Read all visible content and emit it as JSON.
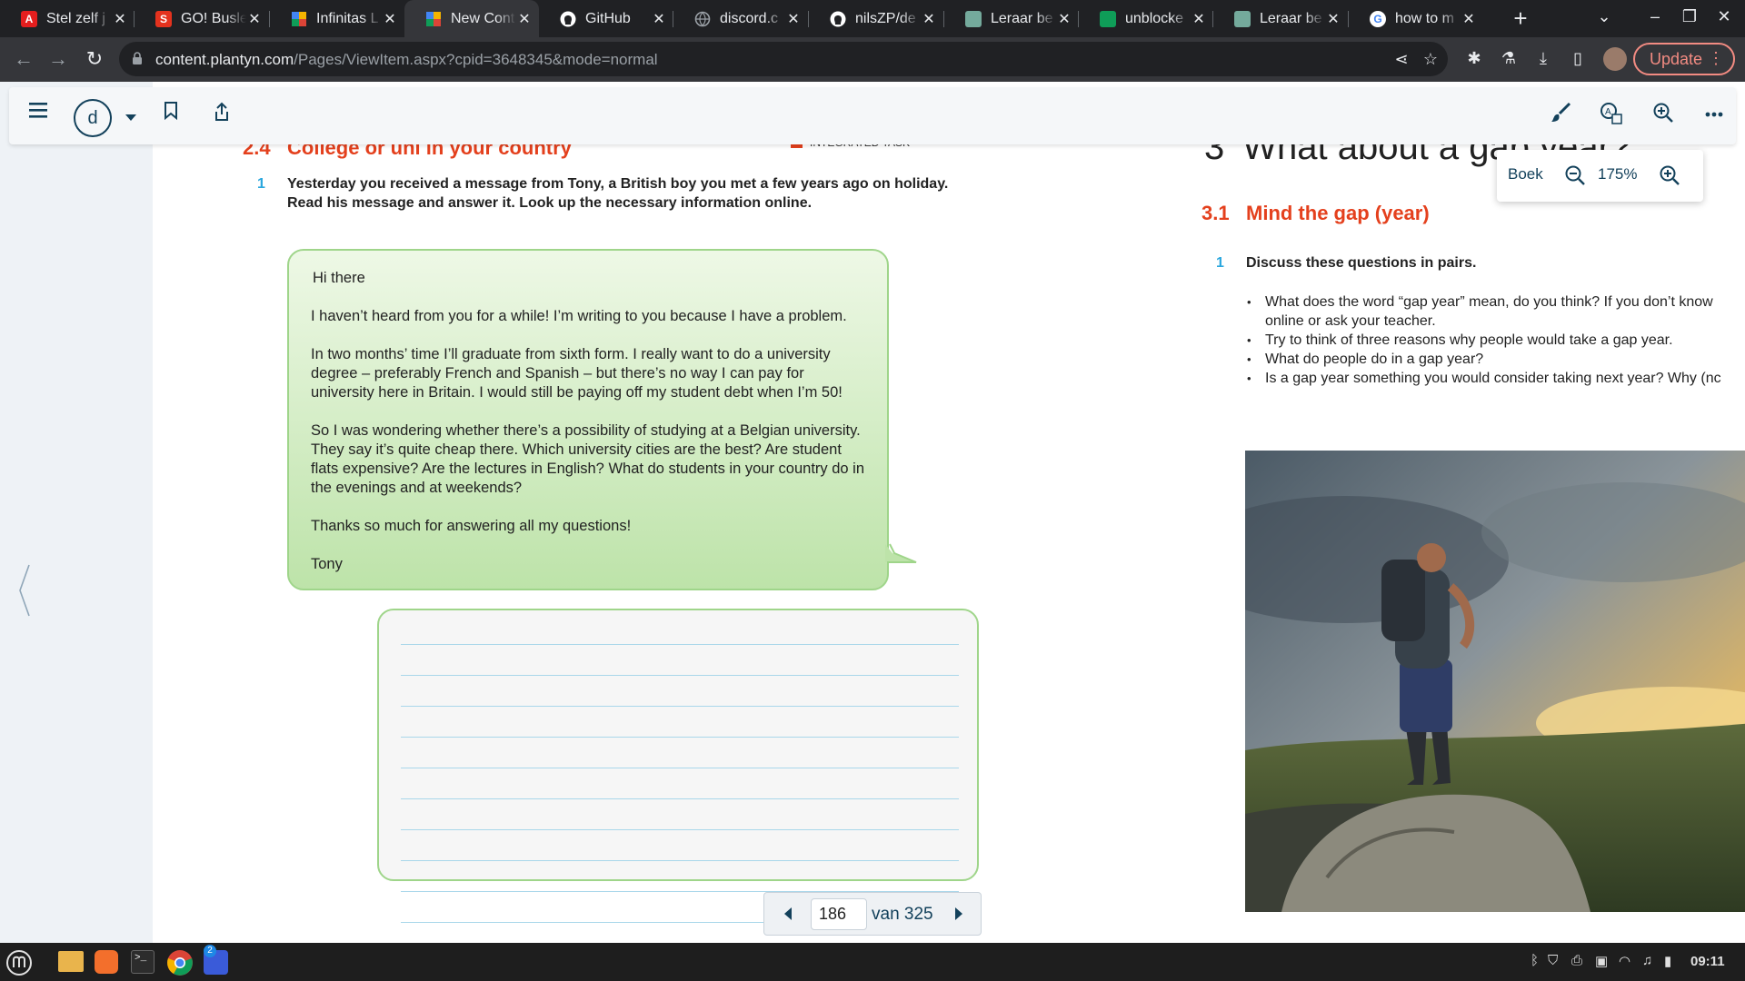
{
  "browser": {
    "tabs": [
      {
        "title": "Stel zelf j",
        "icon": "adobe-icon",
        "color": "#e41e1e",
        "glyph": "A"
      },
      {
        "title": "GO! Busle",
        "icon": "s-logo-icon",
        "color": "#e4321e",
        "glyph": "S"
      },
      {
        "title": "Infinitas L",
        "icon": "infinitas-icon",
        "color": "#f4b400",
        "glyph": ""
      },
      {
        "title": "New Cont",
        "icon": "new-content-icon",
        "color": "#f4b400",
        "glyph": ""
      },
      {
        "title": "GitHub",
        "icon": "github-icon",
        "color": "#ffffff",
        "glyph": ""
      },
      {
        "title": "discord.c",
        "icon": "globe-icon",
        "color": "#9aa0a6",
        "glyph": ""
      },
      {
        "title": "nilsZP/de",
        "icon": "github-icon",
        "color": "#ffffff",
        "glyph": ""
      },
      {
        "title": "Leraar be",
        "icon": "chatgpt-icon",
        "color": "#74aa9c",
        "glyph": ""
      },
      {
        "title": "unblocke",
        "icon": "sheets-icon",
        "color": "#0f9d58",
        "glyph": ""
      },
      {
        "title": "Leraar be",
        "icon": "chatgpt-icon",
        "color": "#74aa9c",
        "glyph": ""
      },
      {
        "title": "how to m",
        "icon": "google-icon",
        "color": "#ffffff",
        "glyph": "G"
      }
    ],
    "url_host": "content.plantyn.com",
    "url_path": "/Pages/ViewItem.aspx?cpid=3648345&mode=normal",
    "update_label": "Update"
  },
  "app": {
    "avatar_letter": "d",
    "zoom": {
      "book_label": "Boek",
      "value": "175%"
    },
    "pager": {
      "current": "186",
      "of_label": "van 325"
    }
  },
  "left_page": {
    "section_number": "2.4",
    "section_title": "College or uni in your country",
    "task_label": "INTEGRATED TASK",
    "exercise_number": "1",
    "instruction": "Yesterday you received a message from Tony, a British boy you met a few years ago on holiday. Read his message and answer it. Look up the necessary information online.",
    "message": {
      "greeting": "Hi there",
      "paragraphs": [
        "I haven’t heard from you for a while! I’m writing to you because I have a problem.",
        "In two months’ time I’ll graduate from sixth form. I really want to do a university degree – preferably French and Spanish – but there’s no way I can pay for university here in Britain. I would still be paying off my student debt when I’m 50!",
        "So I was wondering whether there’s a possibility of studying at a Belgian university. They say it’s quite cheap there. Which university cities are the best? Are student flats expensive? Are the lectures in English? What do students in your country do in the evenings and at weekends?",
        "Thanks so much for answering all my questions!"
      ],
      "signature": "Tony"
    }
  },
  "right_page": {
    "chapter_number": "3",
    "chapter_title": "What about a gap year?",
    "section_number": "3.1",
    "section_title": "Mind the gap (year)",
    "exercise_number": "1",
    "instruction": "Discuss these questions in pairs.",
    "questions": [
      "What does the word “gap year” mean, do you think? If you don’t know\nonline or ask your teacher.",
      "Try to think of three reasons why people would take a gap year.",
      "What do people do in a gap year?",
      "Is a gap year something you would consider taking next year? Why (nc"
    ]
  },
  "taskbar": {
    "clock": "09:11",
    "badge_count": "2"
  }
}
